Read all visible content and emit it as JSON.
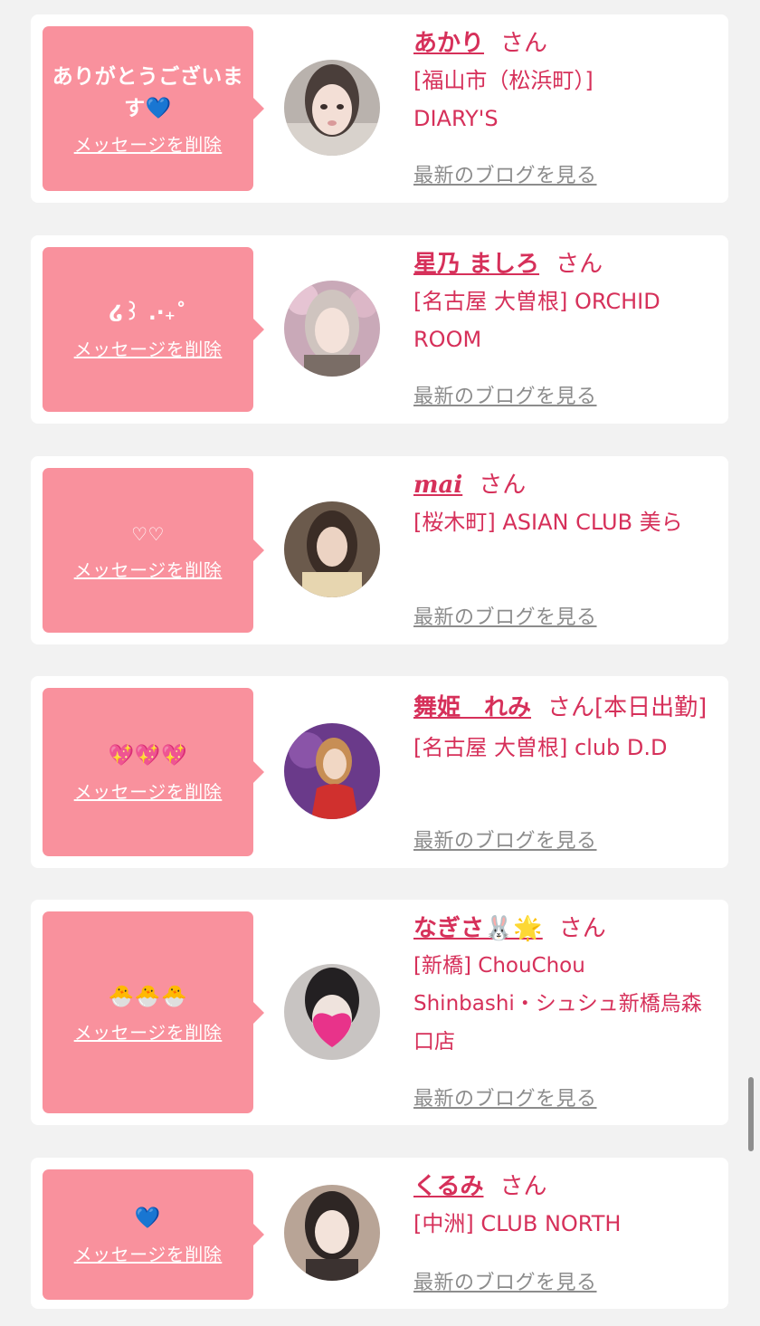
{
  "delete_label": "メッセージを削除",
  "blog_label": "最新のブログを見る",
  "honorific": "さん",
  "cards": [
    {
      "message": "ありがとうございます💙",
      "name": "あかり",
      "extra": "",
      "shop": "[福山市（松浜町）] DIARY'S"
    },
    {
      "message": "໒꒱ .‧₊˚",
      "name": "星乃 ましろ",
      "extra": "",
      "shop": "[名古屋 大曽根] ORCHID ROOM"
    },
    {
      "message": "♡♡",
      "name": "mai",
      "extra": "",
      "shop": "[桜木町] ASIAN CLUB 美ら"
    },
    {
      "message": "💖💖💖",
      "name": "舞姫　れみ",
      "extra": "[本日出勤]",
      "shop": "[名古屋 大曽根] club D.D"
    },
    {
      "message": "🐣🐣🐣",
      "name": "なぎさ🐰🌟",
      "extra": "",
      "shop": "[新橋] ChouChou Shinbashi・シュシュ新橋烏森口店"
    },
    {
      "message": "💙",
      "name": "くるみ",
      "extra": "",
      "shop": "[中洲] CLUB NORTH"
    }
  ],
  "colors": {
    "background": "#f2f2f2",
    "bubble": "#f9919d",
    "accent": "#d6305a",
    "blog_link": "#8c8c8c"
  }
}
